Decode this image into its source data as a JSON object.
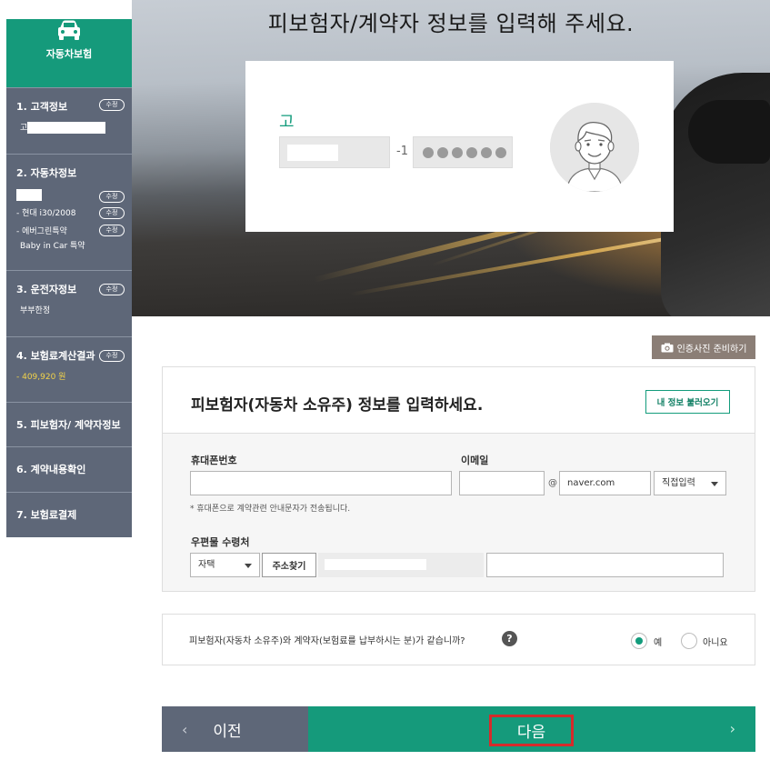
{
  "headline": "피보험자/계약자 정보를 입력해 주세요.",
  "profile": {
    "name": "고",
    "id_dash": "-1",
    "id_masked_dots": 6
  },
  "sidebar": {
    "brand_label": "자동차보험",
    "edit_label": "수정",
    "steps": [
      {
        "title": "1. 고객정보",
        "sub": "고"
      },
      {
        "title": "2. 자동차정보",
        "sub1": "- 현대 i30/2008",
        "sub2": "- 에버그린특약",
        "sub3": "Baby in Car 특약"
      },
      {
        "title": "3. 운전자정보",
        "sub": "부부한정"
      },
      {
        "title": "4. 보험료계산결과",
        "sub": "- 409,920 원"
      },
      {
        "title": "5. 피보험자/ 계약자정보"
      },
      {
        "title": "6. 계약내용확인"
      },
      {
        "title": "7. 보험료결제"
      }
    ]
  },
  "photo_button": "인증사진 준비하기",
  "section": {
    "heading": "피보험자(자동차 소유주) 정보를 입력하세요.",
    "load_button": "내 정보 불러오기"
  },
  "form": {
    "phone_label": "휴대폰번호",
    "phone_value": "",
    "email_label": "이메일",
    "email_user": "",
    "at": "@",
    "email_domain": "naver.com",
    "domain_select": "직접입력",
    "phone_note": "* 휴대폰으로 계약관련 안내문자가 전송됩니다.",
    "mail_label": "우편물 수령처",
    "mail_select": "자택",
    "address_button": "주소찾기",
    "address_detail": ""
  },
  "question": {
    "text": "피보험자(자동차 소유주)와 계약자(보험료를 납부하시는 분)가 같습니까?",
    "help": "?",
    "yes": "예",
    "no": "아니요",
    "selected": "yes"
  },
  "nav": {
    "prev_arrow": "‹",
    "prev": "이전",
    "next": "다음",
    "next_arrow": "›"
  },
  "colors": {
    "brand_green": "#159a7b",
    "sidebar_slate": "#5e6778",
    "highlight_red": "#d52b2b"
  }
}
